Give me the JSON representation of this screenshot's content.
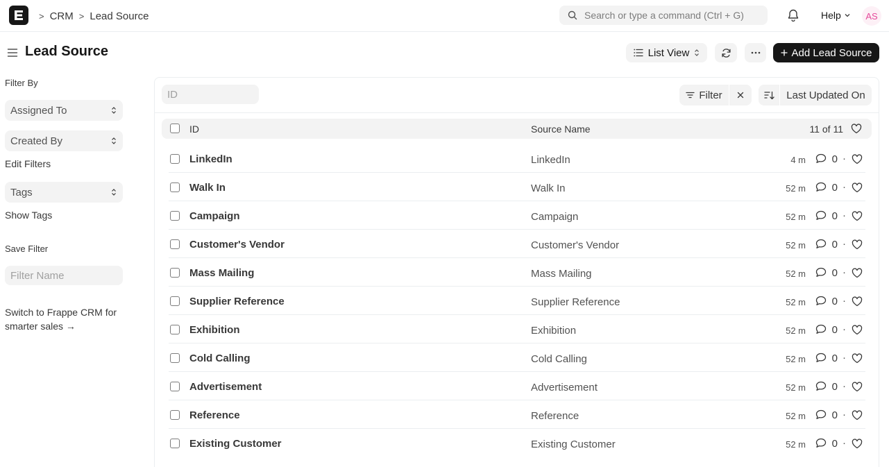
{
  "navbar": {
    "breadcrumbs": [
      "CRM",
      "Lead Source"
    ],
    "search_placeholder": "Search or type a command (Ctrl + G)",
    "help_label": "Help",
    "avatar_initials": "AS"
  },
  "header": {
    "title": "Lead Source",
    "view_label": "List View",
    "add_label": "Add Lead Source"
  },
  "sidebar": {
    "filter_by": "Filter By",
    "assigned_to": "Assigned To",
    "created_by": "Created By",
    "edit_filters": "Edit Filters",
    "tags": "Tags",
    "show_tags": "Show Tags",
    "save_filter": "Save Filter",
    "filter_name_placeholder": "Filter Name",
    "switch_line1": "Switch to Frappe CRM for",
    "switch_line2": "smarter sales →"
  },
  "list": {
    "id_placeholder": "ID",
    "filter_label": "Filter",
    "sort_label": "Last Updated On",
    "columns": {
      "id": "ID",
      "source_name": "Source Name"
    },
    "count_label": "11 of 11",
    "rows": [
      {
        "name": "LinkedIn",
        "source": "LinkedIn",
        "time": "4 m",
        "comments": "0"
      },
      {
        "name": "Walk In",
        "source": "Walk In",
        "time": "52 m",
        "comments": "0"
      },
      {
        "name": "Campaign",
        "source": "Campaign",
        "time": "52 m",
        "comments": "0"
      },
      {
        "name": "Customer's Vendor",
        "source": "Customer's Vendor",
        "time": "52 m",
        "comments": "0"
      },
      {
        "name": "Mass Mailing",
        "source": "Mass Mailing",
        "time": "52 m",
        "comments": "0"
      },
      {
        "name": "Supplier Reference",
        "source": "Supplier Reference",
        "time": "52 m",
        "comments": "0"
      },
      {
        "name": "Exhibition",
        "source": "Exhibition",
        "time": "52 m",
        "comments": "0"
      },
      {
        "name": "Cold Calling",
        "source": "Cold Calling",
        "time": "52 m",
        "comments": "0"
      },
      {
        "name": "Advertisement",
        "source": "Advertisement",
        "time": "52 m",
        "comments": "0"
      },
      {
        "name": "Reference",
        "source": "Reference",
        "time": "52 m",
        "comments": "0"
      },
      {
        "name": "Existing Customer",
        "source": "Existing Customer",
        "time": "52 m",
        "comments": "0"
      }
    ]
  }
}
